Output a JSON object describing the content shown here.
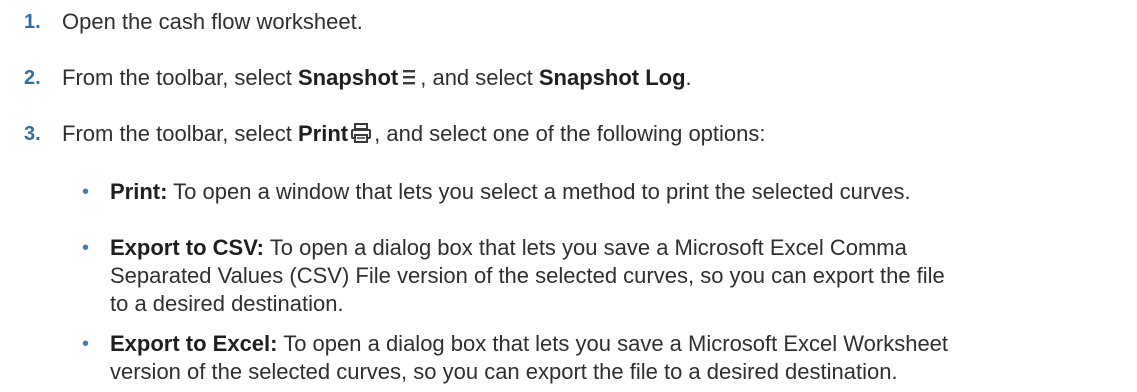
{
  "steps": [
    {
      "number": "1.",
      "text": "Open the cash flow worksheet."
    },
    {
      "number": "2.",
      "pre": "From the toolbar, select ",
      "bold1": "Snapshot",
      "icon1": "menu-lines-icon",
      "mid": ", and select ",
      "bold2": "Snapshot Log",
      "post": "."
    },
    {
      "number": "3.",
      "pre": "From the toolbar, select ",
      "bold1": "Print",
      "icon1": "print-icon",
      "post": ", and select one of the following options:"
    }
  ],
  "options": [
    {
      "label": "Print:",
      "desc": " To open a window that lets you select a method to print the selected curves."
    },
    {
      "label": "Export to CSV:",
      "desc1": " To open a dialog box that lets you save a Microsoft Excel Comma",
      "desc2": "Separated Values (CSV) File version of the selected curves, so you can export the file",
      "desc3": "to a desired destination."
    },
    {
      "label": "Export to Excel:",
      "desc1": " To open a dialog box that lets you save a Microsoft Excel Worksheet",
      "desc2": "version of the selected curves, so you can export the file to a desired destination."
    }
  ],
  "bullet_char": "•"
}
